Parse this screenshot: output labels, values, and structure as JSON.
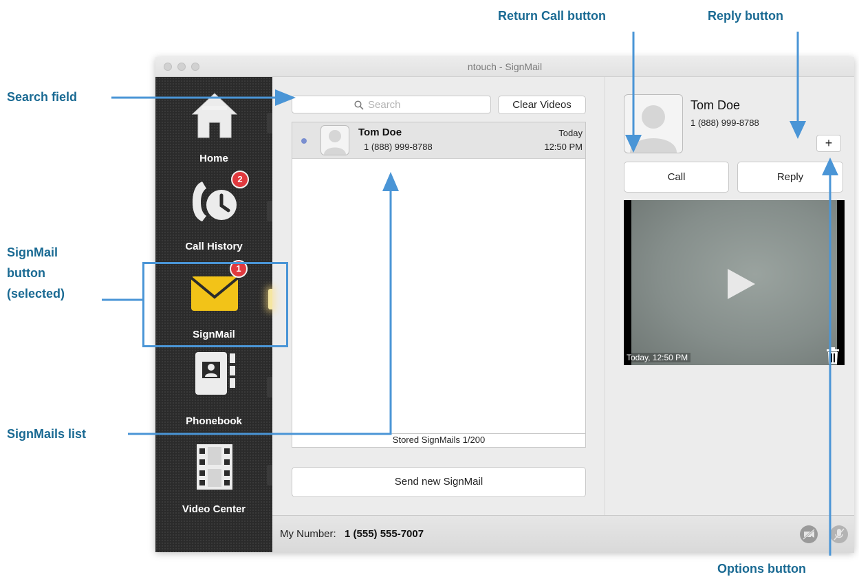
{
  "annotations": {
    "return_call": "Return Call button",
    "reply": "Reply button",
    "search_field": "Search field",
    "signmail_button": [
      "SignMail",
      "button",
      "(selected)"
    ],
    "signmails_list": "SignMails list",
    "options": "Options button"
  },
  "window": {
    "title": "ntouch - SignMail"
  },
  "sidebar": {
    "items": [
      {
        "label": "Home",
        "icon": "home-icon"
      },
      {
        "label": "Call History",
        "icon": "call-history-icon",
        "badge": "2"
      },
      {
        "label": "SignMail",
        "icon": "envelope-icon",
        "badge": "1",
        "selected": true
      },
      {
        "label": "Phonebook",
        "icon": "phonebook-icon"
      },
      {
        "label": "Video Center",
        "icon": "film-icon"
      }
    ]
  },
  "search": {
    "placeholder": "Search"
  },
  "toolbar": {
    "clear_videos": "Clear Videos"
  },
  "signmails": [
    {
      "name": "Tom Doe",
      "number": "1 (888) 999-8788",
      "date": "Today",
      "time": "12:50 PM",
      "unread": true
    }
  ],
  "stored": "Stored SignMails 1/200",
  "send_new": "Send new SignMail",
  "detail": {
    "name": "Tom Doe",
    "number": "1 (888) 999-8788",
    "options_label": "+",
    "call_label": "Call",
    "reply_label": "Reply",
    "video_timestamp": "Today, 12:50 PM"
  },
  "footer": {
    "my_number_label": "My Number:",
    "my_number": "1 (555) 555-7007"
  },
  "colors": {
    "annotation": "#1a6a93",
    "arrow": "#4a95d6",
    "badge": "#e0393e",
    "signmail_icon": "#f2c318"
  }
}
